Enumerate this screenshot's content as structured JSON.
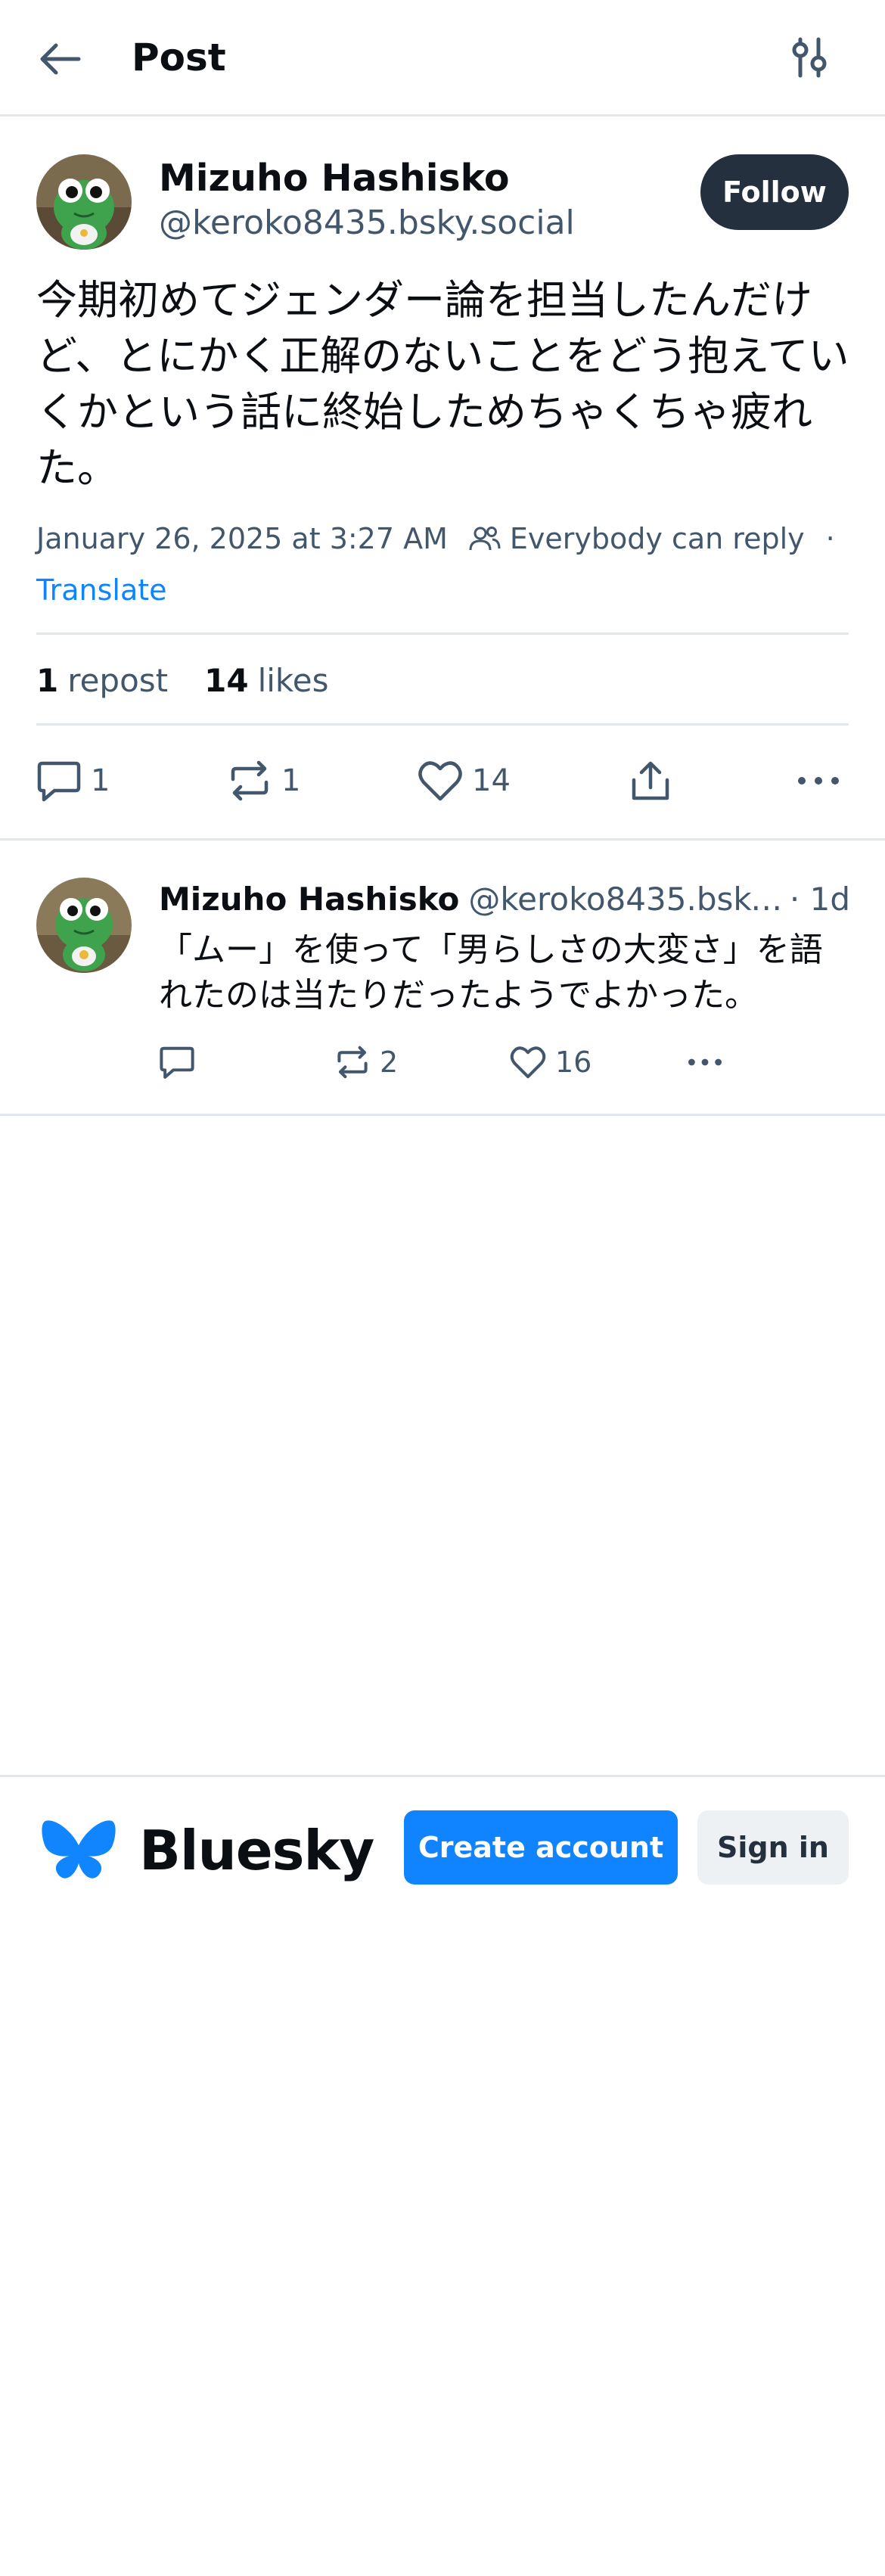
{
  "header": {
    "title": "Post",
    "back_icon": "arrow-left-icon",
    "settings_icon": "sliders-icon"
  },
  "post": {
    "author_name": "Mizuho Hashisko",
    "author_handle": "@keroko8435.bsky.social",
    "follow_label": "Follow",
    "text": "今期初めてジェンダー論を担当したんだけど、とにかく正解のないことをどう抱えていくかという話に終始しためちゃくちゃ疲れた。",
    "timestamp": "January 26, 2025 at 3:27 AM",
    "reply_setting": "Everybody can reply",
    "separator": "·",
    "translate_label": "Translate",
    "repost_count": "1",
    "repost_label": "repost",
    "like_count": "14",
    "like_label": "likes",
    "actions": {
      "reply_count": "1",
      "repost_count": "1",
      "like_count": "14"
    }
  },
  "reply": {
    "author_name": "Mizuho Hashisko",
    "author_handle": "@keroko8435.bsky...",
    "time": "· 1d",
    "text": "「ムー」を使って「男らしさの大変さ」を語れたのは当たりだったようでよかった。",
    "repost_count": "2",
    "like_count": "16"
  },
  "footer": {
    "brand": "Bluesky",
    "create_label": "Create account",
    "signin_label": "Sign in"
  },
  "colors": {
    "accent": "#1083fe",
    "muted_text": "#42576c",
    "follow_bg": "#24303d",
    "divider": "#e3e7eb"
  }
}
